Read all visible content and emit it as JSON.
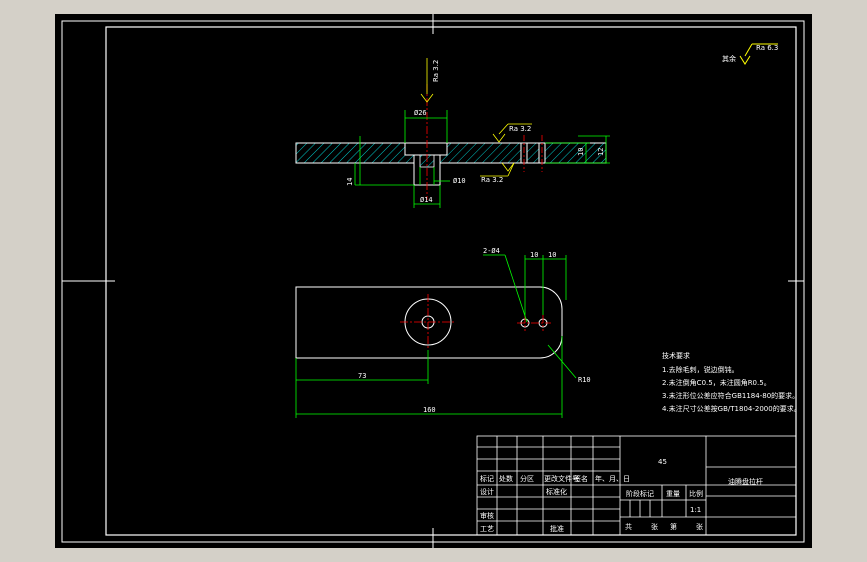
{
  "drawing": {
    "background": "#000000",
    "outer_bg": "#d4d0c8",
    "colors": {
      "outline": "#ffffff",
      "dimension": "#00ff00",
      "center_line": "#ff0000",
      "hatch": "#00ffff",
      "annotation": "#ffff00"
    }
  },
  "roughness": {
    "general": {
      "label": "其余",
      "value": "Ra 6.3"
    },
    "top_bore": "Ra 3.2",
    "top_face": "Ra 3.2",
    "bottom_face": "Ra 3.2"
  },
  "section_view": {
    "dim_bore": "Ø26",
    "dim_shaft": "Ø10",
    "dim_base": "Ø14",
    "dim_depth": "14",
    "dim_thick_inner": "10",
    "dim_thick_outer": "12"
  },
  "plan_view": {
    "hole_label": "2-Ø4",
    "dim_spacing_1": "10",
    "dim_spacing_2": "10",
    "dim_radius": "R10",
    "dim_center": "73",
    "dim_total": "160"
  },
  "tech_notes": {
    "title": "技术要求",
    "items": [
      "1.去除毛刺，锐边倒钝。",
      "2.未注倒角C0.5，未注圆角R0.5。",
      "3.未注形位公差应符合GB1184-80的要求。",
      "4.未注尺寸公差按GB/T1804-2000的要求。"
    ]
  },
  "title_block": {
    "material": "45",
    "part_name": "油腾盘拉杆",
    "headers": [
      "标记",
      "处数",
      "分区",
      "更改文件号",
      "签名",
      "年、月、日"
    ],
    "row_labels": [
      "设计",
      "审核",
      "工艺"
    ],
    "std_label": "标准化",
    "approve_label": "批准",
    "stage_label": "阶段标记",
    "weight_label": "重量",
    "scale_label": "比例",
    "scale_value": "1:1",
    "sheet_info": [
      "共",
      "张",
      "第",
      "张"
    ]
  }
}
